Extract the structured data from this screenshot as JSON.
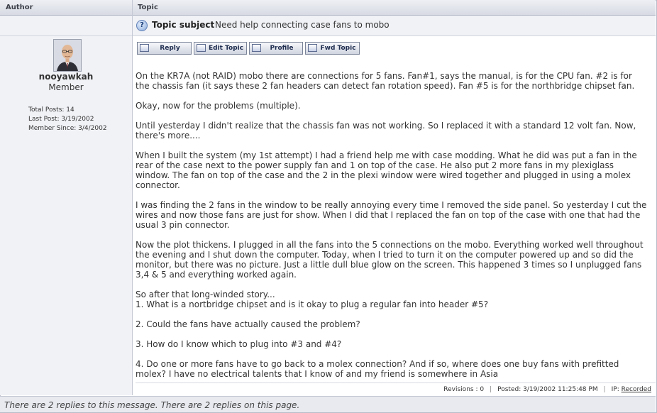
{
  "header": {
    "author_col": "Author",
    "topic_col": "Topic"
  },
  "subject": {
    "label": "Topic subject",
    "value": "Need help connecting case fans to mobo"
  },
  "author": {
    "username": "nooyawkah",
    "rank": "Member",
    "total_posts": "Total Posts: 14",
    "last_post": "Last Post: 3/19/2002",
    "member_since": "Member Since: 3/4/2002"
  },
  "buttons": {
    "reply": "Reply",
    "edit": "Edit Topic",
    "profile": "Profile",
    "fwd": "Fwd Topic"
  },
  "post": {
    "p1": "On the KR7A (not RAID) mobo there are connections for 5 fans. Fan#1, says the manual, is for the CPU fan. #2 is for the chassis fan (it says these 2 fan headers can detect fan rotation speed). Fan #5 is for the northbridge chipset fan.",
    "p2": "Okay, now for the problems (multiple).",
    "p3": "Until yesterday I didn't realize that the chassis fan was not working. So I replaced it with a standard 12 volt fan. Now, there's more....",
    "p4": "When I built the system (my 1st attempt) I had a friend help me with case modding. What he did was put a fan in the rear of the case next to the power supply fan and 1 on top of the case. He also put 2 more fans in my plexiglass window. The fan on top of the case and the 2 in the plexi window were wired together and plugged in using a molex connector.",
    "p5": "I was finding the 2 fans in the window to be really annoying every time I removed the side panel. So yesterday I cut the wires and now those fans are just for show. When I did that I replaced the fan on top of the case with one that had the usual 3 pin connector.",
    "p6": "Now the plot thickens. I plugged in all the fans into the 5 connections on the mobo. Everything worked well throughout the evening and I shut down the computer. Today, when I tried to turn it on the computer powered up and so did the monitor, but there was no picture. Just a little dull blue glow on the screen. This happened 3 times so I unplugged fans 3,4 & 5 and everything worked again.",
    "p7a": "So after that long-winded story...",
    "p7b": "1. What is a nortbridge chipset and is it okay to plug a regular fan into header #5?",
    "q2": "2. Could the fans have actually caused the problem?",
    "q3": "3. How do I know which to plug into #3 and #4?",
    "q4": "4. Do one or more fans have to go back to a molex connection? And if so, where does one buy fans with prefitted molex? I have no electrical talents that I know of and my friend is somewhere in Asia"
  },
  "meta": {
    "revisions": "Revisions : 0",
    "posted": "Posted:  3/19/2002 11:25:48 PM",
    "ip_label": "IP:",
    "ip_value": "Recorded"
  },
  "footer": {
    "text": "There are 2 replies to this message. There are 2 replies on this page."
  }
}
